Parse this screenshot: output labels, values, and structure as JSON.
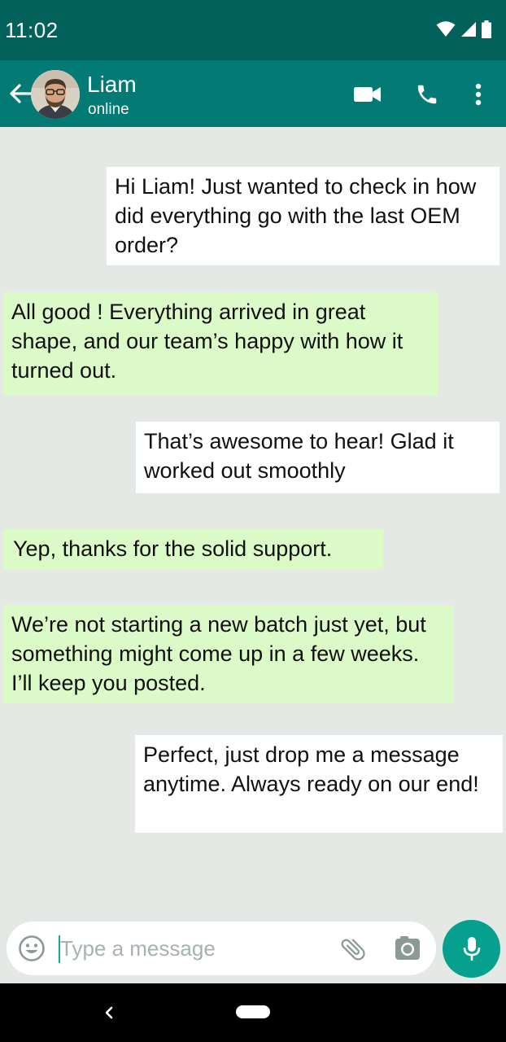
{
  "status_bar": {
    "time": "11:02",
    "icons": [
      "wifi-icon",
      "signal-icon",
      "battery-icon"
    ]
  },
  "header": {
    "contact_name": "Liam",
    "contact_status": "online",
    "actions": [
      "video-call-icon",
      "phone-icon",
      "more-vert-icon"
    ]
  },
  "messages": [
    {
      "direction": "outgoing",
      "text": "Hi Liam! Just wanted to check in how did everything go with the last OEM order?"
    },
    {
      "direction": "incoming",
      "text": "All good ! Everything arrived in great shape, and our team’s happy with how it turned out."
    },
    {
      "direction": "outgoing",
      "text": "That’s awesome to hear! Glad it worked out smoothly"
    },
    {
      "direction": "incoming",
      "text": "Yep, thanks for the solid support."
    },
    {
      "direction": "incoming",
      "text": "We’re not starting a new batch just yet, but something might come up in a few weeks. I’ll keep you posted."
    },
    {
      "direction": "outgoing",
      "text": "Perfect, just drop me a message anytime. Always ready on our end!"
    }
  ],
  "composer": {
    "placeholder": "Type a message",
    "value": ""
  },
  "colors": {
    "status_bar": "#03615c",
    "app_bar": "#047a74",
    "chat_background": "#e5e9e6",
    "incoming_bubble": "#dcfac8",
    "outgoing_bubble": "#ffffff",
    "mic_button": "#06a08e"
  }
}
